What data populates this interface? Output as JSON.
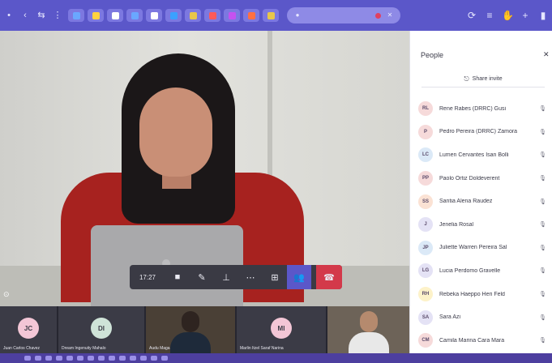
{
  "toolbar": {
    "tabs": [
      {
        "name": "tab-1",
        "color": "#6aa7ff"
      },
      {
        "name": "tab-2",
        "color": "#ffd23f"
      },
      {
        "name": "tab-3",
        "color": "#ffffff"
      },
      {
        "name": "tab-4",
        "color": "#6aa7ff"
      },
      {
        "name": "tab-5",
        "color": "#ffffff"
      },
      {
        "name": "tab-6",
        "color": "#3aa0ff"
      },
      {
        "name": "tab-7",
        "color": "#e8c64a"
      },
      {
        "name": "tab-8",
        "color": "#ff5a5a"
      },
      {
        "name": "tab-9",
        "color": "#c552f0"
      },
      {
        "name": "tab-10",
        "color": "#ff7043"
      },
      {
        "name": "tab-11",
        "color": "#e8c64a"
      }
    ]
  },
  "call_controls": {
    "timer": "17:27"
  },
  "people_panel": {
    "title": "People",
    "share_invite_label": "Share invite",
    "participants": [
      {
        "initials": "RL",
        "name": "Rene Rabes (DRRC) Gusi",
        "color": "#f6dada"
      },
      {
        "initials": "P",
        "name": "Pedro Pereira (DRRC) Zamora",
        "color": "#f6dada"
      },
      {
        "initials": "LC",
        "name": "Lumen Cervantes Isan Bolli",
        "color": "#dbe9f7"
      },
      {
        "initials": "PP",
        "name": "Paolo Ortiz Doldeverent",
        "color": "#f6dada"
      },
      {
        "initials": "SS",
        "name": "Santia Alena Raudez",
        "color": "#fbe2d4"
      },
      {
        "initials": "J",
        "name": "Jenelia Rosal",
        "color": "#e4e2f5"
      },
      {
        "initials": "JP",
        "name": "Juliette Warren Pereira Sal",
        "color": "#dbe9f7"
      },
      {
        "initials": "LG",
        "name": "Lucia Perdomo Gravelle",
        "color": "#e4e2f5"
      },
      {
        "initials": "RH",
        "name": "Rebeka Haeppo Heri Feld",
        "color": "#fdf2c9"
      },
      {
        "initials": "SA",
        "name": "Sara Azi",
        "color": "#e4e2f5"
      },
      {
        "initials": "CM",
        "name": "Camila Marina Cara Mara",
        "color": "#f6dada"
      }
    ]
  },
  "participant_strip": {
    "tiles": [
      {
        "initials": "JC",
        "name": "Juan Carlos Chavez",
        "avatar_color": "#f3c6d6",
        "width": 70
      },
      {
        "initials": "DI",
        "name": "Dream Ingenuity Mahalo",
        "avatar_color": "#cfe3d8",
        "width": 106
      },
      {
        "initials": "",
        "name": "Audu Maga",
        "avatar_color": "",
        "width": 110
      },
      {
        "initials": "MI",
        "name": "Marlin Itzel Saraf Narina",
        "avatar_color": "#f3c6d6",
        "width": 110
      },
      {
        "initials": "",
        "name": "",
        "avatar_color": "",
        "width": 101
      }
    ]
  }
}
